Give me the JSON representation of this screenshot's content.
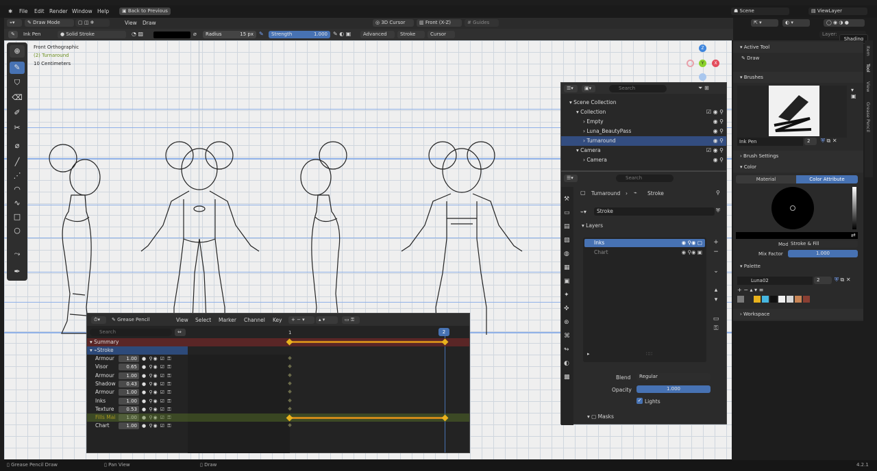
{
  "menubar": {
    "items": [
      "File",
      "Edit",
      "Render",
      "Window",
      "Help"
    ],
    "back_button": "Back to Previous",
    "scene": "Scene",
    "view_layer": "ViewLayer"
  },
  "header": {
    "mode": "Draw Mode",
    "menus": [
      "View",
      "Draw"
    ],
    "cursor": "3D Cursor",
    "view": "Front (X-Z)",
    "guides": "Guides"
  },
  "tool_settings": {
    "brush": "Ink Pen",
    "stroke_type": "Solid Stroke",
    "radius_label": "Radius",
    "radius_value": "15 px",
    "strength_label": "Strength",
    "strength_value": "1.000",
    "advanced": "Advanced",
    "stroke": "Stroke",
    "cursor": "Cursor",
    "layer": "Layer:"
  },
  "viewport": {
    "view_name": "Front Orthographic",
    "object": "(2) Turnaround",
    "scale": "10 Centimeters",
    "gizmo": {
      "x": "X",
      "y": "Y",
      "z": "Z"
    }
  },
  "shading_tooltip": "Shading",
  "sidebar_tabs": [
    "Item",
    "Tool",
    "View",
    "Grease Pencil"
  ],
  "active_tool": {
    "title": "Active Tool",
    "tool": "Draw"
  },
  "brushes": {
    "title": "Brushes",
    "name": "Ink Pen",
    "count": "2"
  },
  "brush_settings": {
    "title": "Brush Settings"
  },
  "color": {
    "title": "Color",
    "tab_material": "Material",
    "tab_attribute": "Color Attribute",
    "mode_label": "Mode",
    "mode_value": "Stroke & Fill",
    "mix_label": "Mix Factor",
    "mix_value": "1.000"
  },
  "palette": {
    "title": "Palette",
    "name": "Luna02",
    "count": "2",
    "swatches": [
      "#7a7a7a",
      "#2b2b2b",
      "#e8b21d",
      "#46b6e0",
      "#101010",
      "#f2f2f2",
      "#d8d8d8",
      "#c88455",
      "#8a3f33"
    ]
  },
  "workspace": {
    "title": "Workspace"
  },
  "outliner": {
    "search": "Search",
    "rows": [
      {
        "label": "Scene Collection",
        "indent": 0
      },
      {
        "label": "Collection",
        "indent": 1
      },
      {
        "label": "Empty",
        "indent": 2
      },
      {
        "label": "Luna_BeautyPass",
        "indent": 2
      },
      {
        "label": "Turnaround",
        "indent": 2,
        "selected": true
      },
      {
        "label": "Camera",
        "indent": 1
      },
      {
        "label": "Camera",
        "indent": 2
      }
    ]
  },
  "properties": {
    "search": "Search",
    "breadcrumb_object": "Turnaround",
    "breadcrumb_data": "Stroke",
    "data_name": "Stroke",
    "layers_title": "Layers",
    "layers": [
      {
        "name": "Inks",
        "selected": true
      },
      {
        "name": "Chart",
        "selected": false
      }
    ],
    "blend_label": "Blend",
    "blend_value": "Regular",
    "opacity_label": "Opacity",
    "opacity_value": "1.000",
    "lights_label": "Lights",
    "masks_label": "Masks"
  },
  "dopesheet": {
    "mode": "Grease Pencil",
    "menus": [
      "View",
      "Select",
      "Marker",
      "Channel",
      "Key"
    ],
    "search": "Search",
    "frame_1": "1",
    "frame_2": "2",
    "summary": "Summary",
    "object": "Stroke",
    "channels": [
      {
        "name": "Armour",
        "value": "1.00"
      },
      {
        "name": "Visor",
        "value": "0.65"
      },
      {
        "name": "Armour",
        "value": "1.00"
      },
      {
        "name": "Shadow",
        "value": "0.43"
      },
      {
        "name": "Armour",
        "value": "1.00"
      },
      {
        "name": "Inks",
        "value": "1.00"
      },
      {
        "name": "Texture",
        "value": "0.53"
      },
      {
        "name": "Fills Mai",
        "value": "1.00",
        "highlight": true
      },
      {
        "name": "Chart",
        "value": "1.00"
      }
    ]
  },
  "status": {
    "left": "Grease Pencil Draw",
    "middle": "Pan View",
    "right": "Draw",
    "version": "4.2.1"
  },
  "colors": {
    "accent": "#4772b3",
    "summary": "#6b2f2f",
    "key_orange": "#d08a1a"
  }
}
